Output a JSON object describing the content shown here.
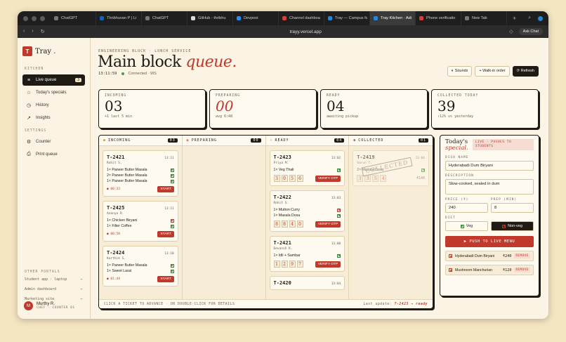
{
  "browser": {
    "tabs": [
      {
        "label": "ChatGPT",
        "color": "#777777"
      },
      {
        "label": "Thribhuvan P | Li",
        "color": "#0a66c2"
      },
      {
        "label": "ChatGPT",
        "color": "#777777"
      },
      {
        "label": "GitHub - thribhu",
        "color": "#dddddd"
      },
      {
        "label": "Devpost",
        "color": "#1e90ff"
      },
      {
        "label": "Channel dashboa",
        "color": "#e53935"
      },
      {
        "label": "Tray — Campus fc",
        "color": "#1e88e5"
      },
      {
        "label": "Tray Kitchen · Adi",
        "color": "#1e88e5"
      },
      {
        "label": "Phone verificatio",
        "color": "#e53935"
      },
      {
        "label": "New Tab",
        "color": "#777777"
      }
    ],
    "url": "trayy.vercel.app",
    "ask_chat": "Ask Chat"
  },
  "sidebar": {
    "logo_letter": "T",
    "logo_text": "Tray .",
    "kitchen_label": "KITCHEN",
    "kitchen_items": [
      {
        "label": "Live queue",
        "badge": "3",
        "icon": "list-icon"
      },
      {
        "label": "Today's specials",
        "icon": "star-icon"
      },
      {
        "label": "History",
        "icon": "clock-icon"
      },
      {
        "label": "Insights",
        "icon": "trend-icon"
      }
    ],
    "settings_label": "SETTINGS",
    "settings_items": [
      {
        "label": "Counter",
        "icon": "gear-icon"
      },
      {
        "label": "Print queue",
        "icon": "printer-icon"
      }
    ],
    "portals_label": "OTHER PORTALS",
    "portals": [
      {
        "label": "Student app · laptop"
      },
      {
        "label": "Admin dashboard"
      },
      {
        "label": "Marketing site"
      }
    ],
    "user": {
      "initial": "M",
      "name": "Murthy R.",
      "role": "CHEF · COUNTER 01"
    }
  },
  "header": {
    "breadcrumb": "ENGINEERING BLOCK · LUNCH SERVICE",
    "title_main": "Main block ",
    "title_accent": "queue.",
    "clock": "13:11:59",
    "connection": "Connected · WS",
    "sounds": "Sounds",
    "walkin": "+ Walk-in order",
    "refresh": "⟳ Refresh"
  },
  "stats": [
    {
      "label": "INCOMING",
      "value": "03",
      "sub": "+1 last 5 min"
    },
    {
      "label": "PREPARING",
      "value": "00",
      "sub": "avg 6:48"
    },
    {
      "label": "READY",
      "value": "04",
      "sub": "awaiting pickup"
    },
    {
      "label": "COLLECTED TODAY",
      "value": "39",
      "sub": "↑12% vs yesterday"
    }
  ],
  "board": {
    "columns": [
      {
        "title": "INCOMING",
        "count": "03"
      },
      {
        "title": "PREPARING",
        "count": "00"
      },
      {
        "title": "READY",
        "count": "04"
      },
      {
        "title": "COLLECTED",
        "count": "01"
      }
    ],
    "incoming": [
      {
        "id": "T-2421",
        "time": "13:11",
        "name": "Rohit S.",
        "items": [
          "1× Paneer Butter Masala",
          "2× Paneer Butter Masala",
          "1× Paneer Butter Masala"
        ],
        "timer": "00:33",
        "action": "START"
      },
      {
        "id": "T-2425",
        "time": "13:11",
        "name": "Ananya R.",
        "items": [
          "1× Chicken Biryani",
          "1× Filter Coffee"
        ],
        "timer": "00:50",
        "action": "START"
      },
      {
        "id": "T-2424",
        "time": "13:10",
        "name": "Karthik S.",
        "items": [
          "1× Paneer Butter Masala",
          "1× Sweet Lassi"
        ],
        "timer": "01:44",
        "action": "START"
      }
    ],
    "ready": [
      {
        "id": "T-2423",
        "time": "13:02",
        "name": "Priya M.",
        "items": [
          "1× Veg Thali"
        ],
        "otp": [
          "3",
          "0",
          "5",
          "6"
        ],
        "action": "VERIFY OTP"
      },
      {
        "id": "T-2422",
        "time": "13:03",
        "name": "Rohit S.",
        "items": [
          "1× Mutton Curry",
          "1× Masala Dosa"
        ],
        "otp": [
          "8",
          "8",
          "4",
          "0"
        ],
        "action": "VERIFY OTP"
      },
      {
        "id": "T-2421",
        "time": "13:00",
        "name": "Devansh K.",
        "items": [
          "1× Idli + Sambar"
        ],
        "otp": [
          "1",
          "2",
          "9",
          "7"
        ],
        "action": "VERIFY OTP"
      },
      {
        "id": "T-2420",
        "time": "13:04"
      }
    ],
    "collected": [
      {
        "id": "T-2419",
        "time": "13:04",
        "name": "Varun T.",
        "items": [
          "2× Masala Dosa"
        ],
        "otp": [
          "3",
          "3",
          "5",
          "4"
        ],
        "price": "₹140",
        "stamp": "COLLECTED"
      }
    ],
    "footer_hint": "CLICK A TICKET TO ADVANCE · OR DOUBLE-CLICK FOR DETAILS",
    "last_update_label": "Last update: ",
    "last_update_value": "T-2423 → ready"
  },
  "specials": {
    "title_1": "Today's",
    "title_2": "special.",
    "live_tag": "LIVE · PUSHES TO STUDENTS",
    "dish_label": "DISH NAME",
    "dish_value": "Hyderabadi Dum Biryani",
    "desc_label": "DESCRIPTION",
    "desc_value": "Slow-cooked, sealed in dum",
    "price_label": "PRICE (₹)",
    "price_value": "240",
    "prep_label": "PREP (MIN)",
    "prep_value": "8",
    "diet_label": "DIET",
    "veg": "Veg",
    "nonveg": "Non-veg",
    "push": "▶ PUSH TO LIVE MENU",
    "list": [
      {
        "name": "Hyderabadi Dum Biryani",
        "price": "₹240",
        "remove": "REMOVE"
      },
      {
        "name": "Mushroom Manchurian",
        "price": "₹120",
        "remove": "REMOVE"
      }
    ]
  }
}
